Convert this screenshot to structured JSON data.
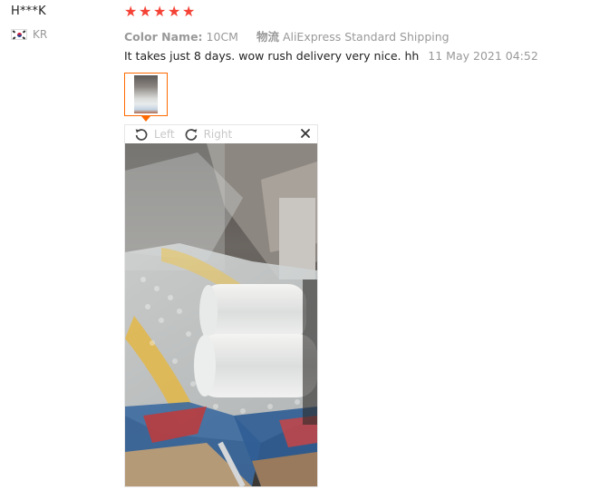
{
  "user": {
    "name": "H***K",
    "country_code": "KR"
  },
  "review": {
    "rating": 5,
    "rating_max": 5,
    "color_label": "Color Name:",
    "color_value": "10CM",
    "shipping_label": "物流",
    "shipping_value": "AliExpress Standard Shipping",
    "text": "It takes just 8 days. wow rush delivery very nice. hh",
    "date": "11 May 2021 04:52",
    "star_color": "#f44336"
  },
  "viewer": {
    "rotate_left_label": "Left",
    "rotate_right_label": "Right",
    "icons": {
      "rotate_left": "rotate-left-icon",
      "rotate_right": "rotate-right-icon",
      "close": "close-icon"
    }
  },
  "colors": {
    "accent": "#ff6a00",
    "muted_text": "#999999"
  }
}
